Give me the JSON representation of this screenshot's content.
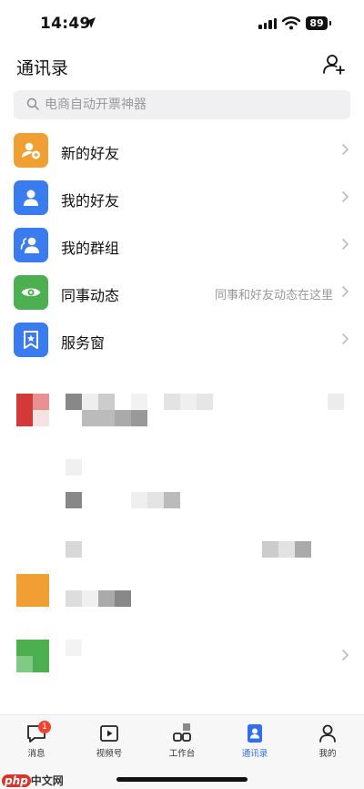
{
  "status_bar": {
    "time": "14:49",
    "battery": "89"
  },
  "header": {
    "title": "通讯录"
  },
  "search": {
    "placeholder": "电商自动开票神器"
  },
  "menu": [
    {
      "label": "新的好友",
      "sub": "",
      "color": "#f0a032"
    },
    {
      "label": "我的好友",
      "sub": "",
      "color": "#3a7bf0"
    },
    {
      "label": "我的群组",
      "sub": "",
      "color": "#3a7bf0"
    },
    {
      "label": "同事动态",
      "sub": "同事和好友动态在这里",
      "color": "#4caf50"
    },
    {
      "label": "服务窗",
      "sub": "",
      "color": "#3a7bf0"
    }
  ],
  "tabs": [
    {
      "label": "消息",
      "badge": "1"
    },
    {
      "label": "视频号"
    },
    {
      "label": "工作台"
    },
    {
      "label": "通讯录",
      "active": true
    },
    {
      "label": "我的"
    }
  ],
  "watermark": {
    "logo": "php",
    "site": "中文网"
  },
  "colors": {
    "accent": "#2f6ff0",
    "badge": "#f0432f"
  }
}
